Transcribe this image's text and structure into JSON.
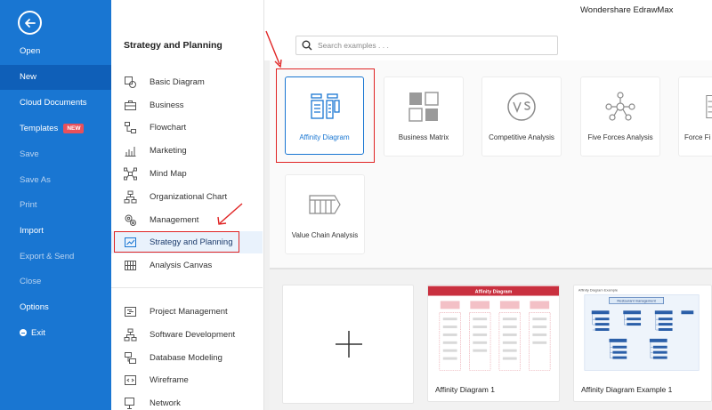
{
  "app": {
    "title": "Wondershare EdrawMax"
  },
  "sidebar": {
    "items": [
      {
        "label": "Open",
        "state": "normal"
      },
      {
        "label": "New",
        "state": "active"
      },
      {
        "label": "Cloud Documents",
        "state": "normal"
      },
      {
        "label": "Templates",
        "state": "normal",
        "badge": "NEW"
      },
      {
        "label": "Save",
        "state": "dim"
      },
      {
        "label": "Save As",
        "state": "dim"
      },
      {
        "label": "Print",
        "state": "dim"
      },
      {
        "label": "Import",
        "state": "normal"
      },
      {
        "label": "Export & Send",
        "state": "dim"
      },
      {
        "label": "Close",
        "state": "dim"
      },
      {
        "label": "Options",
        "state": "normal"
      },
      {
        "label": "Exit",
        "state": "normal"
      }
    ]
  },
  "categories": {
    "title": "Strategy and Planning",
    "items": [
      {
        "label": "Basic Diagram",
        "icon": "basic-diagram-icon"
      },
      {
        "label": "Business",
        "icon": "briefcase-icon"
      },
      {
        "label": "Flowchart",
        "icon": "flowchart-icon"
      },
      {
        "label": "Marketing",
        "icon": "bar-chart-icon"
      },
      {
        "label": "Mind Map",
        "icon": "mind-map-icon"
      },
      {
        "label": "Organizational Chart",
        "icon": "org-chart-icon"
      },
      {
        "label": "Management",
        "icon": "gears-icon"
      },
      {
        "label": "Strategy and Planning",
        "icon": "line-chart-icon",
        "selected": true
      },
      {
        "label": "Analysis Canvas",
        "icon": "canvas-grid-icon"
      },
      {
        "label": "Project Management",
        "icon": "gantt-icon"
      },
      {
        "label": "Software Development",
        "icon": "software-icon"
      },
      {
        "label": "Database Modeling",
        "icon": "database-icon"
      },
      {
        "label": "Wireframe",
        "icon": "wireframe-icon"
      },
      {
        "label": "Network",
        "icon": "network-icon"
      }
    ]
  },
  "search": {
    "placeholder": "Search examples . . ."
  },
  "templates": [
    {
      "label": "Affinity Diagram",
      "icon": "affinity-diagram-icon",
      "selected": true
    },
    {
      "label": "Business Matrix",
      "icon": "business-matrix-icon"
    },
    {
      "label": "Competitive Analysis",
      "icon": "vs-icon"
    },
    {
      "label": "Five Forces Analysis",
      "icon": "five-forces-icon"
    },
    {
      "label": "Force Fi",
      "icon": "force-field-icon"
    },
    {
      "label": "Value Chain Analysis",
      "icon": "value-chain-icon"
    }
  ],
  "examples": [
    {
      "label": "",
      "kind": "blank"
    },
    {
      "label": "Affinity Diagram 1",
      "thumb_title": "Affinity Diagram"
    },
    {
      "label": "Affinity Diagram Example 1",
      "thumb_title": "Affinity Diagram Example",
      "thumb_header": "Restaurant management"
    }
  ],
  "colors": {
    "sidebar": "#1976d2",
    "accent": "#1976d2",
    "highlight": "#e02424"
  }
}
